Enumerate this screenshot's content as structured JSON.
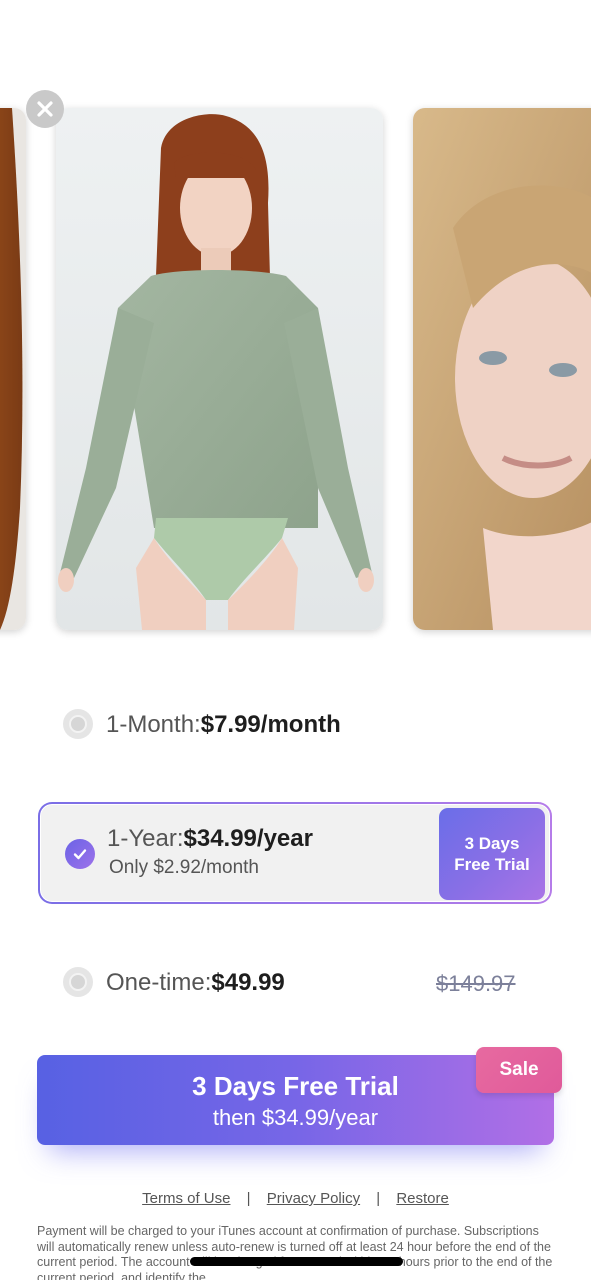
{
  "carousel": {
    "close_icon": "close-icon",
    "photos": [
      "left-partial-photo",
      "main-model-photo",
      "right-model-photo"
    ]
  },
  "plans": {
    "month": {
      "prefix": "1-Month:",
      "price": "$7.99/month",
      "selected": false
    },
    "year": {
      "prefix": "1-Year:",
      "price": "$34.99/year",
      "sub": "Only $2.92/month",
      "badge_line1": "3 Days",
      "badge_line2": "Free Trial",
      "selected": true
    },
    "once": {
      "prefix": "One-time:",
      "price": "$49.99",
      "old_price": "$149.97",
      "selected": false
    }
  },
  "cta": {
    "title": "3 Days Free Trial",
    "subtitle": "then $34.99/year",
    "sale_badge": "Sale"
  },
  "footer": {
    "terms": "Terms of Use",
    "privacy": "Privacy Policy",
    "restore": "Restore",
    "separator": "|",
    "legal": "Payment will be charged to your iTunes account at confirmation of purchase. Subscriptions will automatically renew unless auto-renew is turned off at least 24 hour before the end of the current period. The account will be charged for renewal within 24-hours prior to the end of the current period, and identify the"
  },
  "colors": {
    "accent_start": "#5761e3",
    "accent_end": "#b16fe6",
    "sale": "#e05a9a"
  }
}
